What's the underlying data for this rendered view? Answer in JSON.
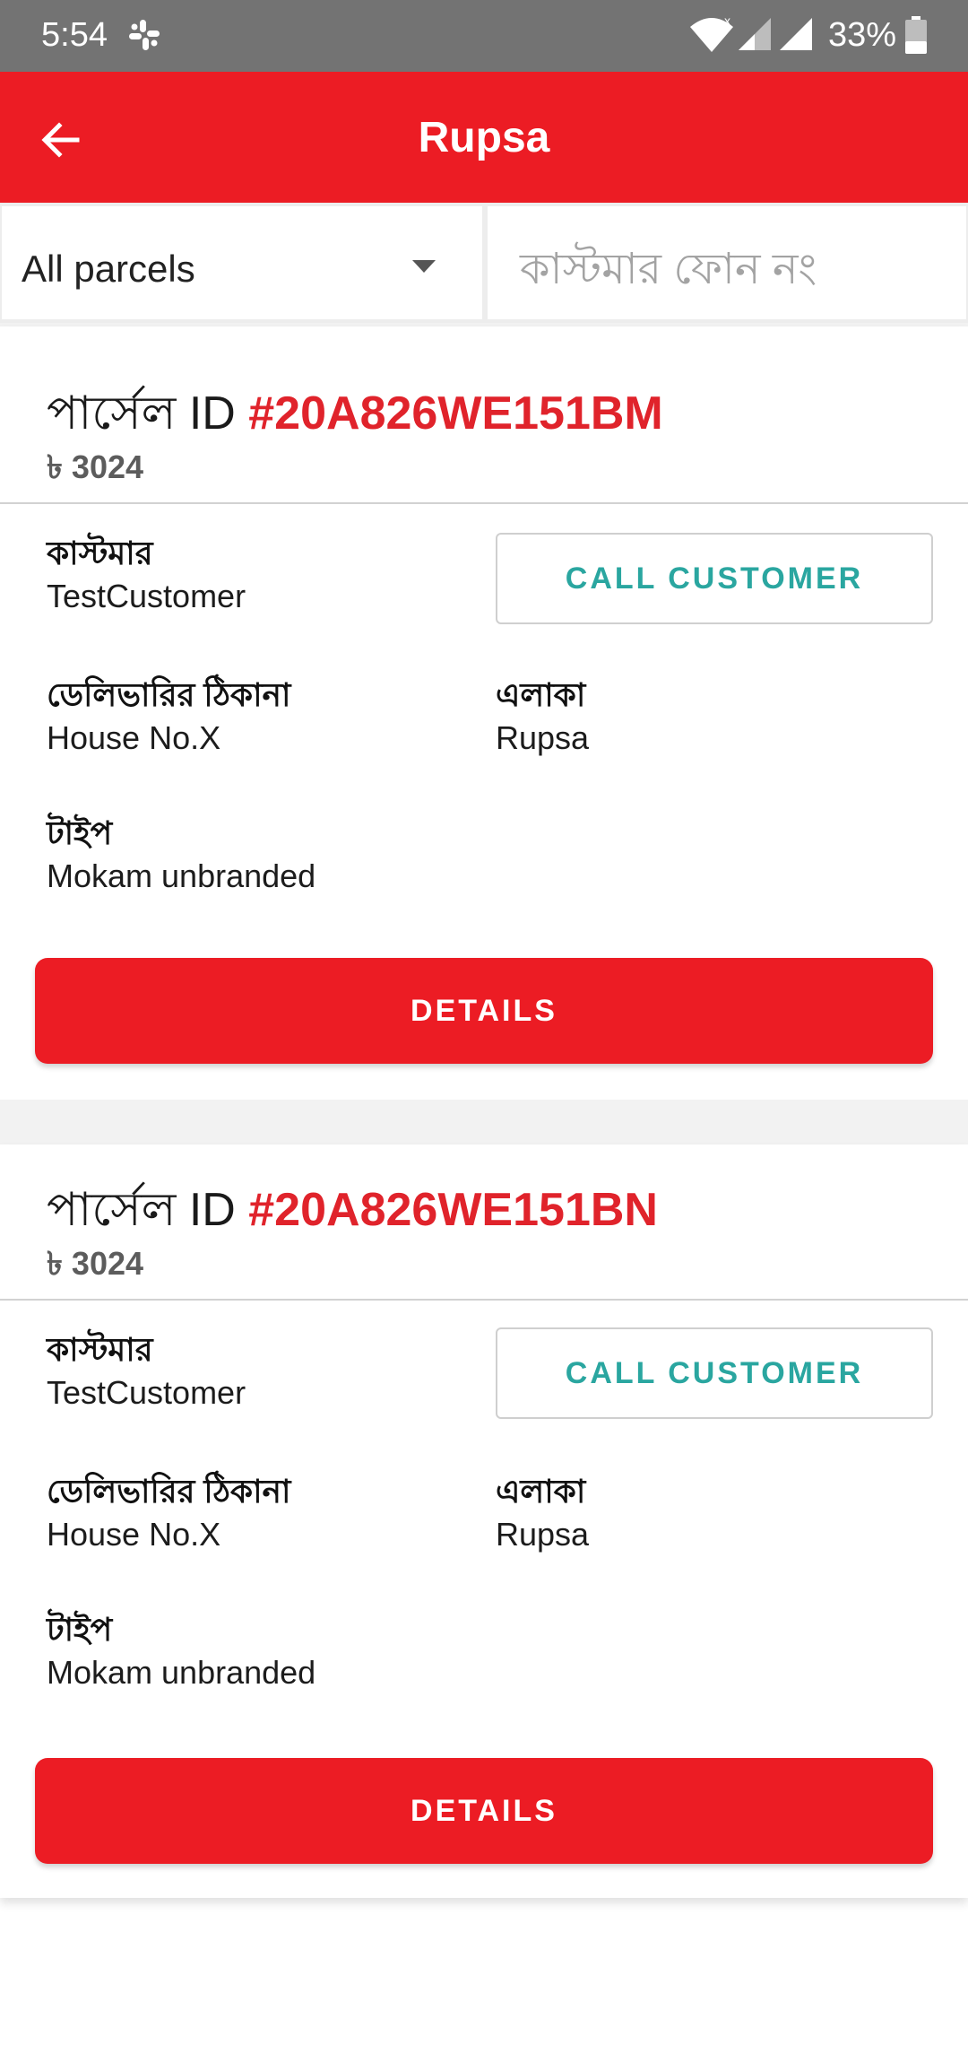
{
  "status_bar": {
    "time": "5:54",
    "battery": "33%",
    "icons": [
      "slack-icon",
      "wifi-icon",
      "signal-icon",
      "battery-icon"
    ]
  },
  "app_bar": {
    "title": "Rupsa",
    "back_icon": "arrow-left-icon",
    "color": "#ec1c24"
  },
  "filters": {
    "status_filter": "All parcels",
    "phone_search_placeholder": "কাস্টমার ফোন নং"
  },
  "labels": {
    "parcel_prefix": "পার্সেল ID ",
    "customer": "কাস্টমার",
    "delivery_address": "ডেলিভারির ঠিকানা",
    "area": "এলাকা",
    "type": "টাইপ",
    "call_customer": "CALL CUSTOMER",
    "details": "DETAILS"
  },
  "parcels": [
    {
      "id": "#20A826WE151BM",
      "price": "৳ 3024",
      "customer": "TestCustomer",
      "delivery_address": "House No.X",
      "area": "Rupsa",
      "type": "Mokam unbranded"
    },
    {
      "id": "#20A826WE151BN",
      "price": "৳ 3024",
      "customer": "TestCustomer",
      "delivery_address": "House No.X",
      "area": "Rupsa",
      "type": "Mokam unbranded"
    }
  ],
  "colors": {
    "brand_red": "#ec1c24",
    "id_red": "#e0232b",
    "call_teal": "#2aa6a0",
    "status_bar_gray": "#737373"
  }
}
